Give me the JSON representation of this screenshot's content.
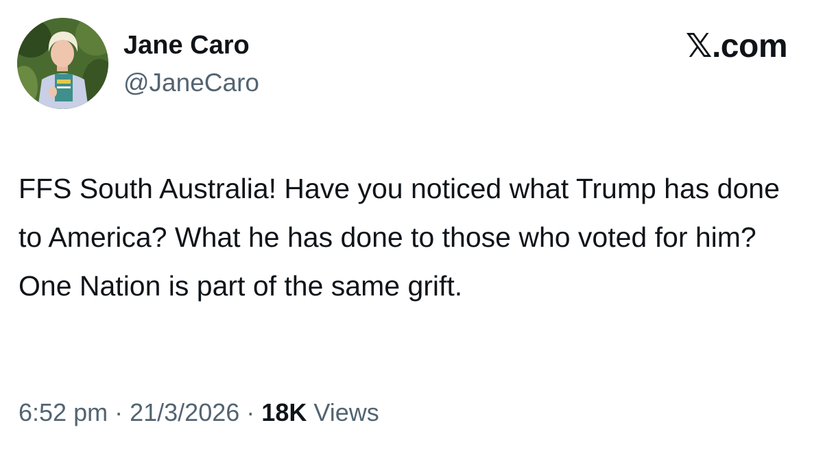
{
  "author": {
    "display_name": "Jane Caro",
    "handle": "@JaneCaro"
  },
  "brand": {
    "label": "𝕏.com"
  },
  "tweet": {
    "text": "FFS South Australia! Have you noticed what Trump has done to America? What he has done to those who voted for him? One Nation is part of the same grift."
  },
  "meta": {
    "time": "6:52 pm",
    "separator": "·",
    "date": "21/3/2026",
    "views_count": "18K",
    "views_label": "Views"
  },
  "colors": {
    "text_primary": "#0f1419",
    "text_secondary": "#536471",
    "background": "#ffffff"
  },
  "icons": {
    "avatar": "profile-photo"
  }
}
